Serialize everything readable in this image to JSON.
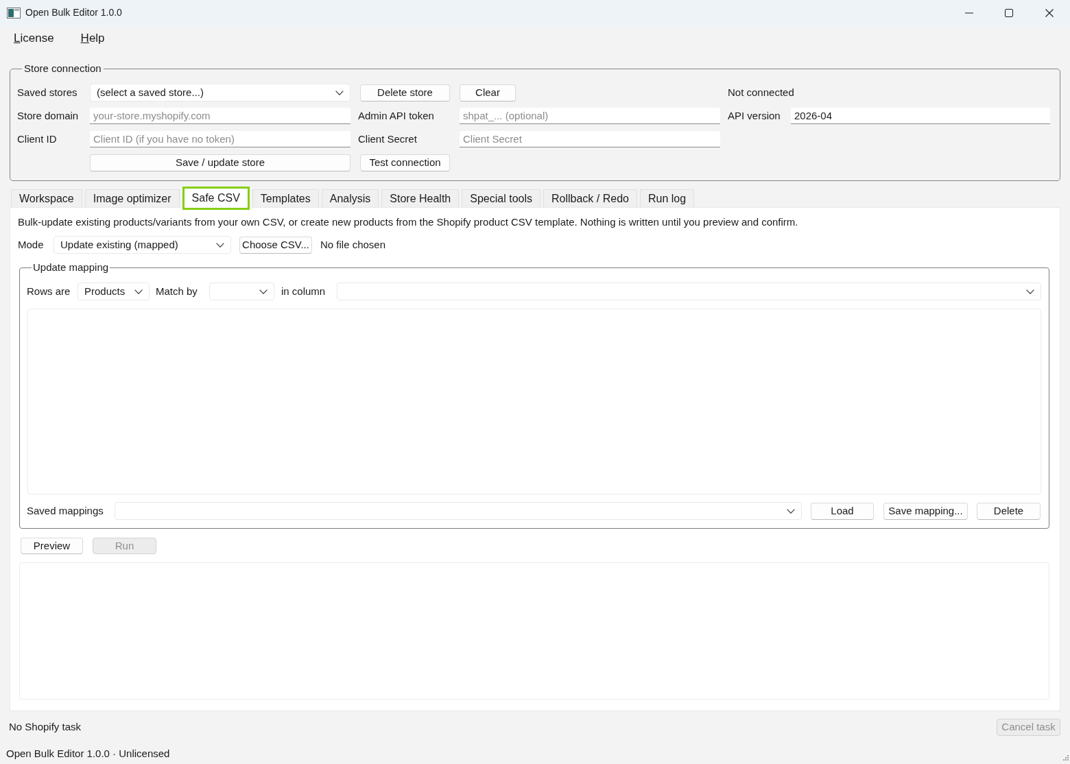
{
  "window": {
    "title": "Open Bulk Editor 1.0.0"
  },
  "menu": [
    {
      "label": "License"
    },
    {
      "label": "Help"
    }
  ],
  "store_connection": {
    "title": "Store connection",
    "saved_stores": {
      "label": "Saved stores",
      "value": "(select a saved store...)"
    },
    "delete_store_button": "Delete store",
    "clear_button": "Clear",
    "connection_status": "Not connected",
    "store_domain": {
      "label": "Store domain",
      "placeholder": "your-store.myshopify.com"
    },
    "admin_api_token": {
      "label": "Admin API token",
      "placeholder": "shpat_... (optional)"
    },
    "api_version": {
      "label": "API version",
      "value": "2026-04"
    },
    "client_id": {
      "label": "Client ID",
      "placeholder": "Client ID (if you have no token)"
    },
    "client_secret": {
      "label": "Client Secret",
      "placeholder": "Client Secret"
    },
    "save_button": "Save / update store",
    "test_button": "Test connection"
  },
  "tabs": [
    {
      "label": "Workspace",
      "selected": false
    },
    {
      "label": "Image optimizer",
      "selected": false
    },
    {
      "label": "Safe CSV",
      "selected": true
    },
    {
      "label": "Templates",
      "selected": false
    },
    {
      "label": "Analysis",
      "selected": false
    },
    {
      "label": "Store Health",
      "selected": false
    },
    {
      "label": "Special tools",
      "selected": false
    },
    {
      "label": "Rollback / Redo",
      "selected": false
    },
    {
      "label": "Run log",
      "selected": false
    }
  ],
  "safe_csv": {
    "description": "Bulk-update existing products/variants from your own CSV, or create new products from the Shopify product CSV template. Nothing is written until you preview and confirm.",
    "mode": {
      "label": "Mode",
      "value": "Update existing (mapped)"
    },
    "choose_button": "Choose CSV...",
    "file_status": "No file chosen",
    "update_mapping": {
      "title": "Update mapping",
      "rows_are": {
        "label": "Rows are",
        "value": "Products"
      },
      "match_by": {
        "label": "Match by"
      },
      "in_column": {
        "label": "in column"
      },
      "saved_mappings": {
        "label": "Saved mappings"
      },
      "mapping_buttons": [
        "Load",
        "Save mapping...",
        "Delete"
      ]
    },
    "preview_button": {
      "label": "Preview",
      "disabled": false
    },
    "run_button": {
      "label": "Run",
      "disabled": true
    }
  },
  "task_status": "No Shopify task",
  "cancel_button": {
    "label": "Cancel task",
    "disabled": true
  },
  "status_bar": "Open Bulk Editor 1.0.0 · Unlicensed"
}
